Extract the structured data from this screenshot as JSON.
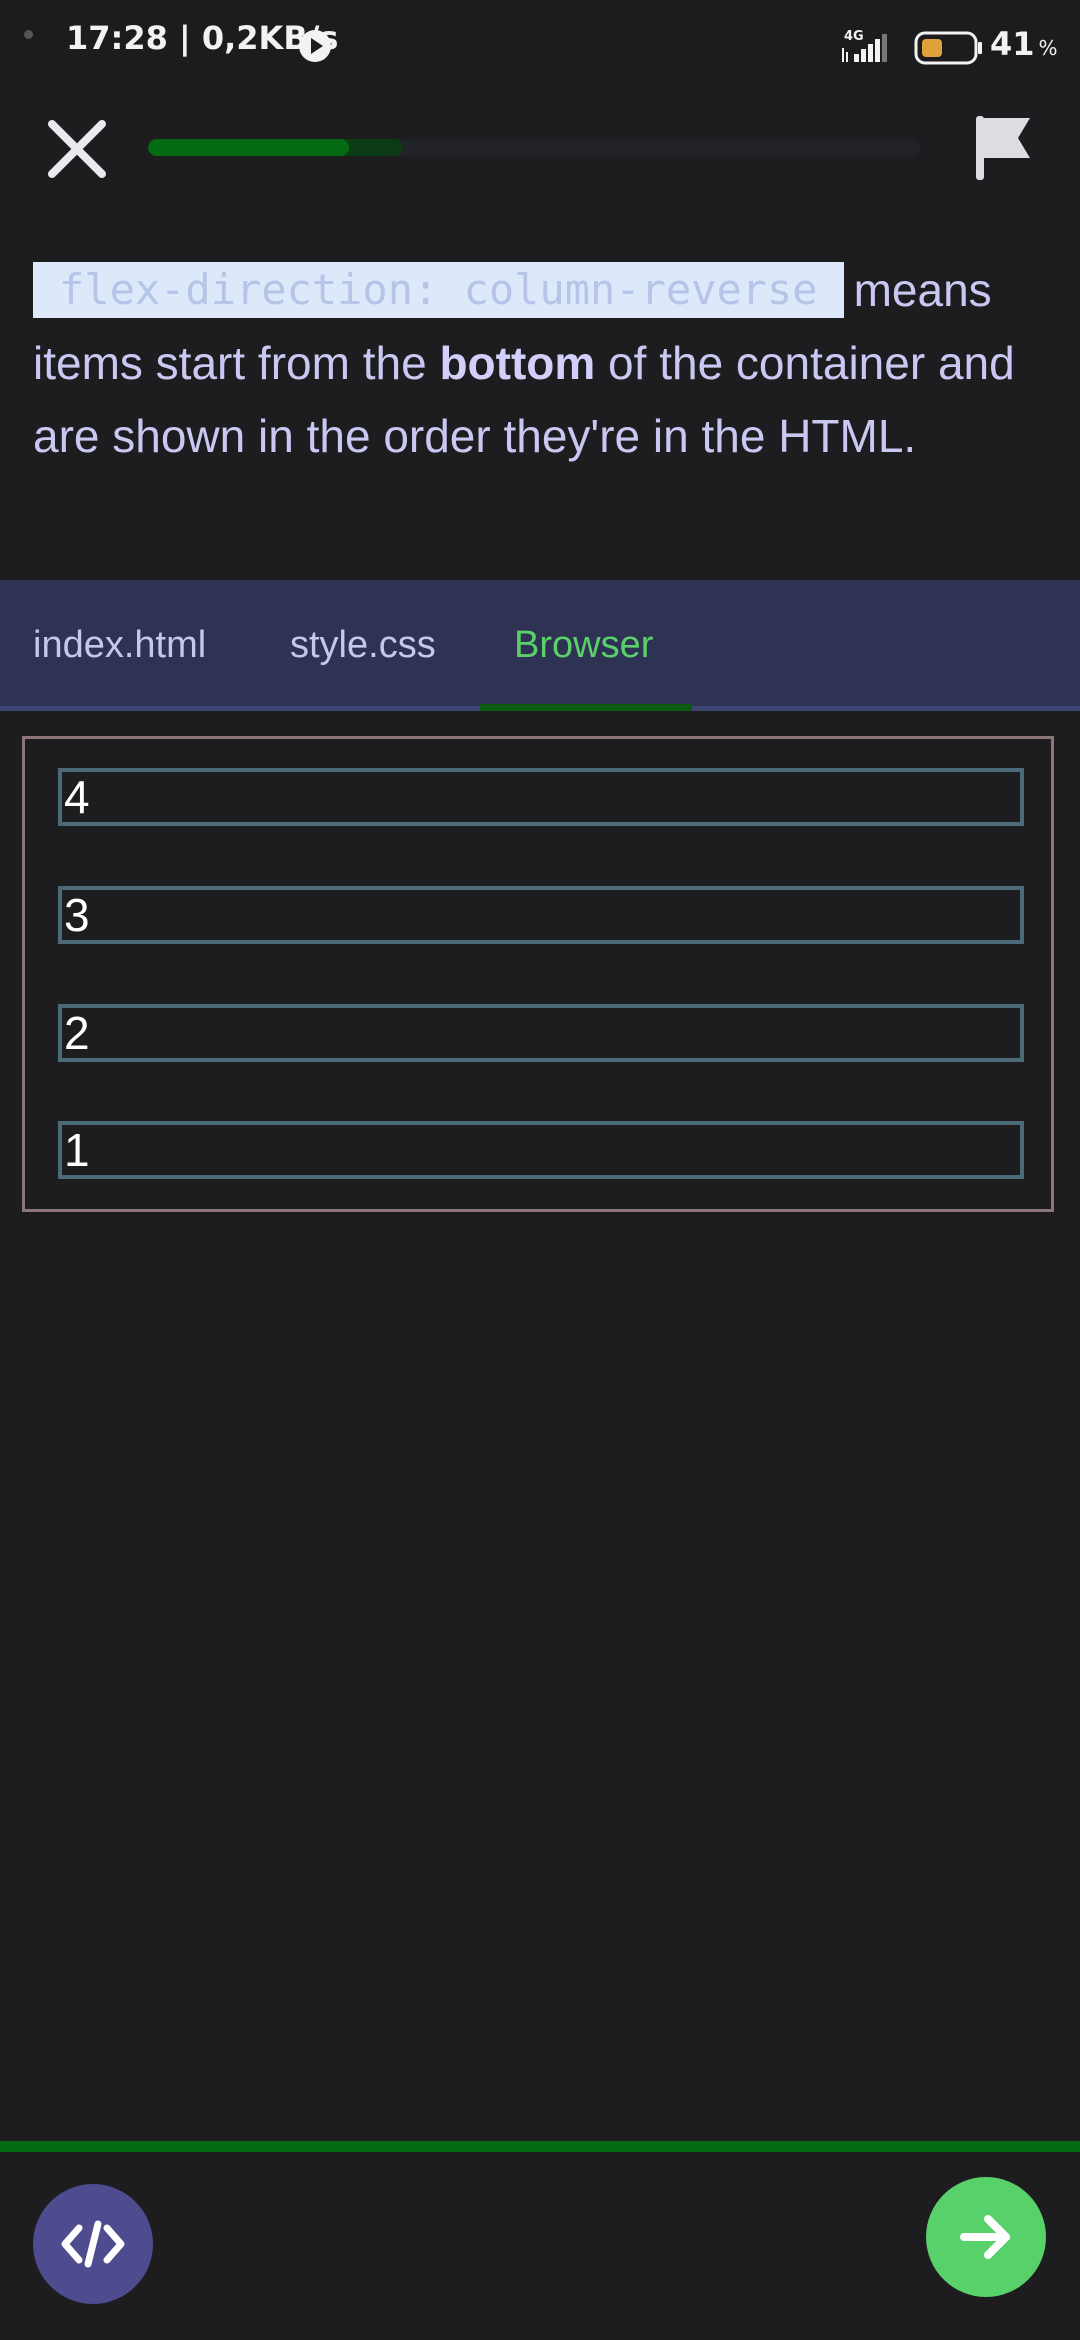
{
  "status_bar": {
    "time": "17:28",
    "speed": "0,2KB/s",
    "network": "4G",
    "battery": "41",
    "battery_unit": "%",
    "battery_level": 0.41,
    "battery_color": "#e0a33a"
  },
  "lesson": {
    "progress": 0.26,
    "progress_ghost": 0.33,
    "progress_color": "#056b12",
    "close_icon": "close-icon",
    "flag_icon": "flag-icon"
  },
  "explanation": {
    "code": "flex-direction: column-reverse",
    "part1": "means items start from the ",
    "bold": "bottom",
    "part2": " of the container and are shown in the order they're in the HTML."
  },
  "tabs": [
    {
      "label": "index.html",
      "active": false
    },
    {
      "label": "style.css",
      "active": false
    },
    {
      "label": "Browser",
      "active": true
    }
  ],
  "browser": {
    "items": [
      "4",
      "3",
      "2",
      "1"
    ]
  },
  "bottom": {
    "code_icon": "code-icon",
    "next_icon": "arrow-right-icon",
    "accent": "#59d16a",
    "code_button_color": "#4e4b8e"
  }
}
